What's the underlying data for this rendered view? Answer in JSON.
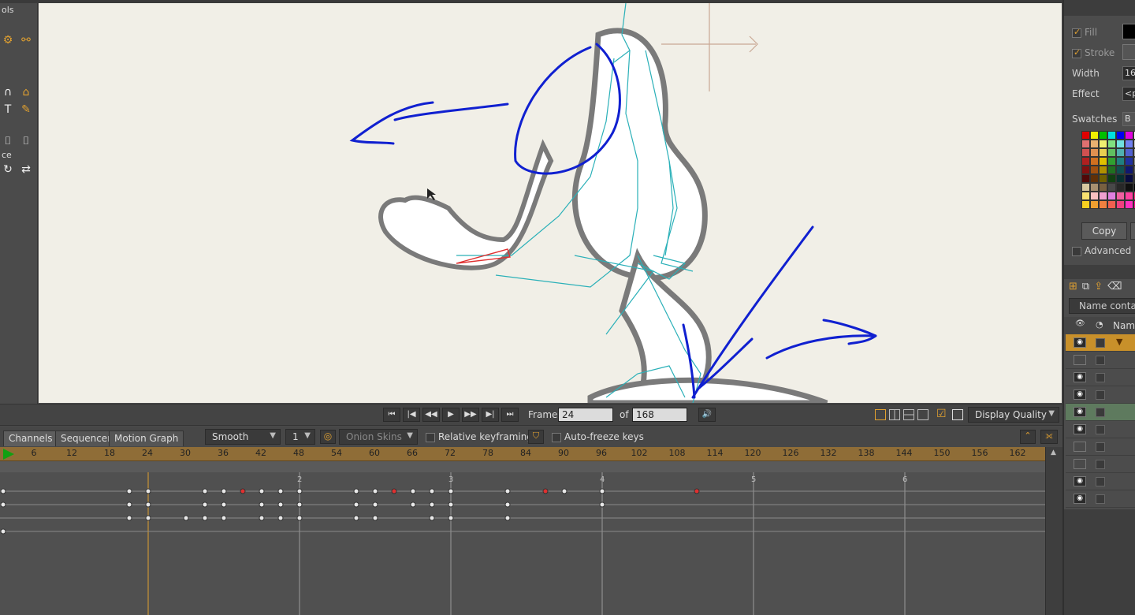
{
  "tools_panel": {
    "title": "ols",
    "section_label": "ce"
  },
  "properties": {
    "fill_label": "Fill",
    "stroke_label": "Stroke",
    "width_label": "Width",
    "width_value": "16",
    "effect_label": "Effect",
    "effect_value": "<p",
    "swatches_label": "Swatches",
    "swatches_dropdown": "B",
    "copy_button": "Copy",
    "advanced_label": "Advanced",
    "name_filter": "Name contain",
    "name_column": "Nam",
    "fill_color": "#000000",
    "stroke_color": "#555555"
  },
  "transport": {
    "frame_label": "Frame",
    "frame_value": "24",
    "of_label": "of",
    "total_frames": "168",
    "display_quality": "Display Quality"
  },
  "timeline": {
    "tabs": [
      "Channels",
      "Sequencer",
      "Motion Graph"
    ],
    "interpolation": "Smooth",
    "step": "1",
    "onion_skins": "Onion Skins",
    "relative_keyframing": "Relative keyframing",
    "auto_freeze": "Auto-freeze keys",
    "ruler_ticks": [
      "6",
      "12",
      "18",
      "24",
      "30",
      "36",
      "42",
      "48",
      "54",
      "60",
      "66",
      "72",
      "78",
      "84",
      "90",
      "96",
      "102",
      "108",
      "114",
      "120",
      "126",
      "132",
      "138",
      "144",
      "150",
      "156",
      "162"
    ],
    "second_markers": [
      "2",
      "3",
      "4",
      "5",
      "6"
    ],
    "current_frame": 24
  },
  "colors": {
    "accent": "#e0a030",
    "ruler": "#8f6d37",
    "bone": "#2ab0b8",
    "sketch": "#1020d0",
    "keyframe_red": "#e03030"
  }
}
